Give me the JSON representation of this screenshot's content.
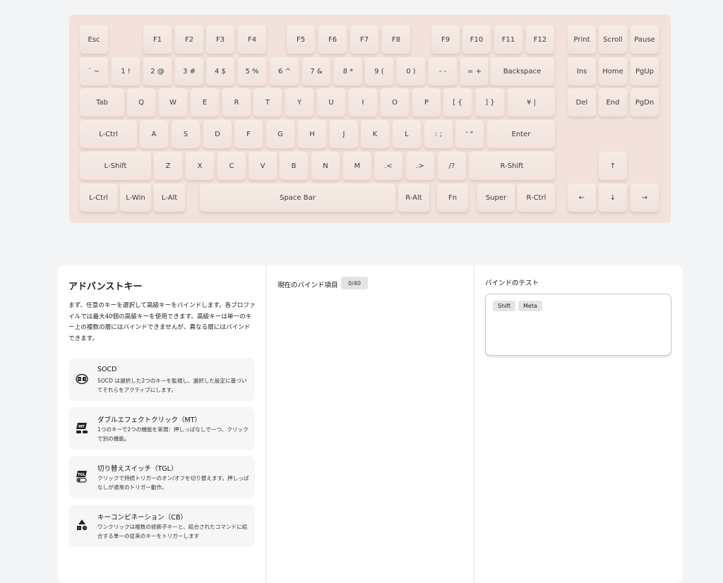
{
  "keyboard": {
    "row1": [
      "Esc",
      "F1",
      "F2",
      "F3",
      "F4",
      "F5",
      "F6",
      "F7",
      "F8",
      "F9",
      "F10",
      "F11",
      "F12",
      "Print",
      "Scroll",
      "Pause"
    ],
    "row2": [
      "` ~",
      "1 !",
      "2 @",
      "3 #",
      "4 $",
      "5 %",
      "6 ^",
      "7 &",
      "8 *",
      "9 (",
      "0 )",
      "- -",
      "= +",
      "Backspace",
      "Ins",
      "Home",
      "PgUp"
    ],
    "row3": [
      "Tab",
      "Q",
      "W",
      "E",
      "R",
      "T",
      "Y",
      "U",
      "I",
      "O",
      "P",
      "[ {",
      "] }",
      "¥ |",
      "Del",
      "End",
      "PgDn"
    ],
    "row4": [
      "L-Ctrl",
      "A",
      "S",
      "D",
      "F",
      "G",
      "H",
      "J",
      "K",
      "L",
      ": ;",
      "' \"",
      "Enter"
    ],
    "row5": [
      "L-Shift",
      "Z",
      "X",
      "C",
      "V",
      "B",
      "N",
      "M",
      ".<",
      ".>",
      "/?",
      "R-Shift",
      "↑"
    ],
    "row6": [
      "L-Ctrl",
      "L-Win",
      "L-Alt",
      "Space Bar",
      "R-Alt",
      "Fn",
      "Super",
      "R-Ctrl",
      "←",
      "↓",
      "→"
    ]
  },
  "advanced": {
    "title": "アドバンストキー",
    "description": "まず、任意のキーを選択して高級キーをバインドします。各プロファイルでは最大40個の高級キーを使用できます。高級キーは単一のキー上の複数の層にはバインドできませんが、異なる層にはバインドできます。",
    "cards": [
      {
        "icon": "socd-icon",
        "title": "SOCD",
        "desc": "SOCD は選択した2つのキーを監視し、選択した設定に基づいてそれらをアクティブにします。"
      },
      {
        "icon": "mt-icon",
        "title": "ダブルエフェクトクリック（MT）",
        "desc": "1つのキーで2つの機能を実現：押しっぱなしで一つ、クリックで別の機能。"
      },
      {
        "icon": "tgl-icon",
        "title": "切り替えスイッチ（TGL）",
        "desc": "クリックで持続トリガーのオン/オフを切り替えます。押しっぱなしが通常のトリガー動作。"
      },
      {
        "icon": "cb-icon",
        "title": "キーコンビネーション（CB）",
        "desc": "ワンクリックは複数の修飾子キーと、結合されたコマンドに結合する単一の従来のキーをトリガーします"
      }
    ]
  },
  "bound": {
    "title": "現在のバインド項目",
    "count": "0/40"
  },
  "test": {
    "title": "バインドのテスト",
    "tags": [
      "Shift",
      "Meta"
    ]
  }
}
